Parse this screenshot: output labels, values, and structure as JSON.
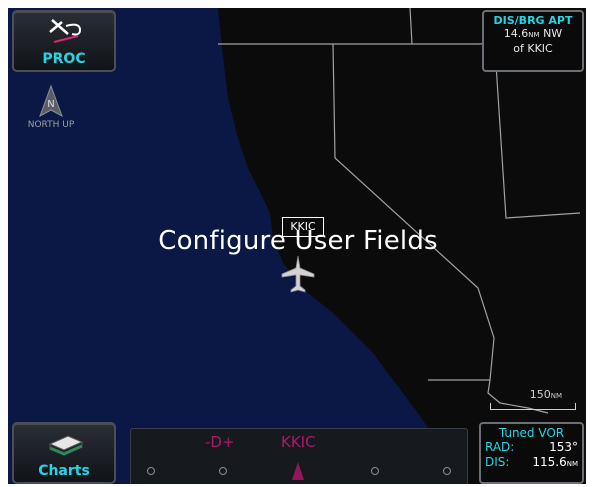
{
  "colors": {
    "ocean": "#0b1744",
    "land": "#0b0b0b",
    "border_lines": "#9ea3a8",
    "accent_cyan": "#27d4e6",
    "waypoint_magenta": "#b0176b"
  },
  "buttons": {
    "proc": {
      "label": "PROC",
      "icon": "procedure-icon"
    },
    "charts": {
      "label": "Charts",
      "icon": "charts-icon"
    }
  },
  "north_up": {
    "label": "NORTH UP",
    "icon": "north-arrow-icon",
    "letter": "N"
  },
  "dis_brg": {
    "header": "DIS/BRG APT",
    "line1_value": "14.6",
    "line1_unit": "NM",
    "line1_dir": "NW",
    "line2": "of KKIC"
  },
  "overlay_message": "Configure User Fields",
  "aircraft": {
    "waypoint_box": "KKIC",
    "icon": "ownship-icon"
  },
  "scale": {
    "value": "150",
    "unit": "NM"
  },
  "flight_plan_strip": {
    "waypoints": [
      "-D+",
      "KKIC"
    ]
  },
  "tuned_vor": {
    "header": "Tuned VOR",
    "rad_label": "RAD:",
    "rad_value": "153°",
    "dis_label": "DIS:",
    "dis_value": "115.6",
    "dis_unit": "NM"
  }
}
